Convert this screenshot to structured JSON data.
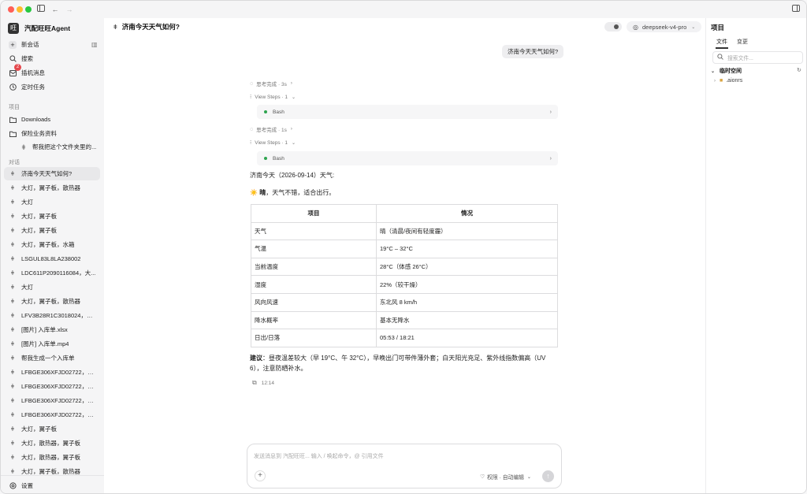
{
  "app": {
    "name": "汽配旺旺Agent"
  },
  "sidebar": {
    "new_chat": "新会话",
    "search": "搜索",
    "bot_messages": "插机消息",
    "bot_badge": "2",
    "scheduled": "定时任务",
    "projects_label": "项目",
    "projects": [
      "Downloads",
      "保险业务资料"
    ],
    "project_sub": "帮我把这个文件夹里的...",
    "conversations_label": "对话",
    "conversations": [
      "济南今天天气如何?",
      "大灯，翼子板，散热器",
      "大灯",
      "大灯，翼子板",
      "大灯，翼子板",
      "大灯，翼子板，水箱",
      "LSGUL83L8LA238002",
      "LDC611P2090116084，大...",
      "大灯",
      "大灯，翼子板，散热器",
      "LFV3B28R1C3018024，水...",
      "[图片] 入库单.xlsx",
      "[图片] 入库单.mp4",
      "帮我生成一个入库单",
      "LFBGE306XFJD02722，大...",
      "LFBGE306XFJD02722，大...",
      "LFBGE306XFJD02722，大...",
      "LFBGE306XFJD02722，大...",
      "大灯，翼子板",
      "大灯，散热器，翼子板",
      "大灯，散热器，翼子板",
      "大灯，翼子板，散热器"
    ],
    "settings": "设置"
  },
  "main": {
    "title": "济南今天天气如何?",
    "model": "deepseek-v4-pro",
    "user_message": "济南今天天气如何?",
    "think1": "思考完成 · 3s",
    "steps1": "View Steps · 1",
    "tool1": "Bash",
    "think2": "思考完成 · 1s",
    "steps2": "View Steps · 1",
    "tool2": "Bash",
    "answer_heading": "济南今天（2026-09-14）天气:",
    "summary_emoji": "☀️",
    "summary_bold": "晴",
    "summary_rest": "，天气不错，适合出行。",
    "table": {
      "headers": [
        "项目",
        "情况"
      ],
      "rows": [
        [
          "天气",
          "晴（清晨/夜间有轻度霾）"
        ],
        [
          "气温",
          "19°C – 32°C"
        ],
        [
          "当前温度",
          "28°C（体感 26°C）"
        ],
        [
          "湿度",
          "22%（较干燥）"
        ],
        [
          "风向风速",
          "东北风 8 km/h"
        ],
        [
          "降水概率",
          "基本无降水"
        ],
        [
          "日出/日落",
          "05:53 / 18:21"
        ]
      ]
    },
    "advice_label": "建议",
    "advice_text": "：昼夜温差较大（早 19°C、午 32°C），早晚出门可带件薄外套；白天阳光充足、紫外线指数偏高（UV 6），注意防晒补水。",
    "time": "12:14",
    "composer_placeholder": "发送消息到 汽配旺旺... 输入 / 唤起命令，@ 引用文件",
    "permission": "权限 · 自动编辑"
  },
  "right_panel": {
    "title": "项目",
    "tab_files": "文件",
    "tab_changes": "变更",
    "search_placeholder": "搜索文件...",
    "workspace": "临时空间",
    "folder": ".aionrs"
  }
}
